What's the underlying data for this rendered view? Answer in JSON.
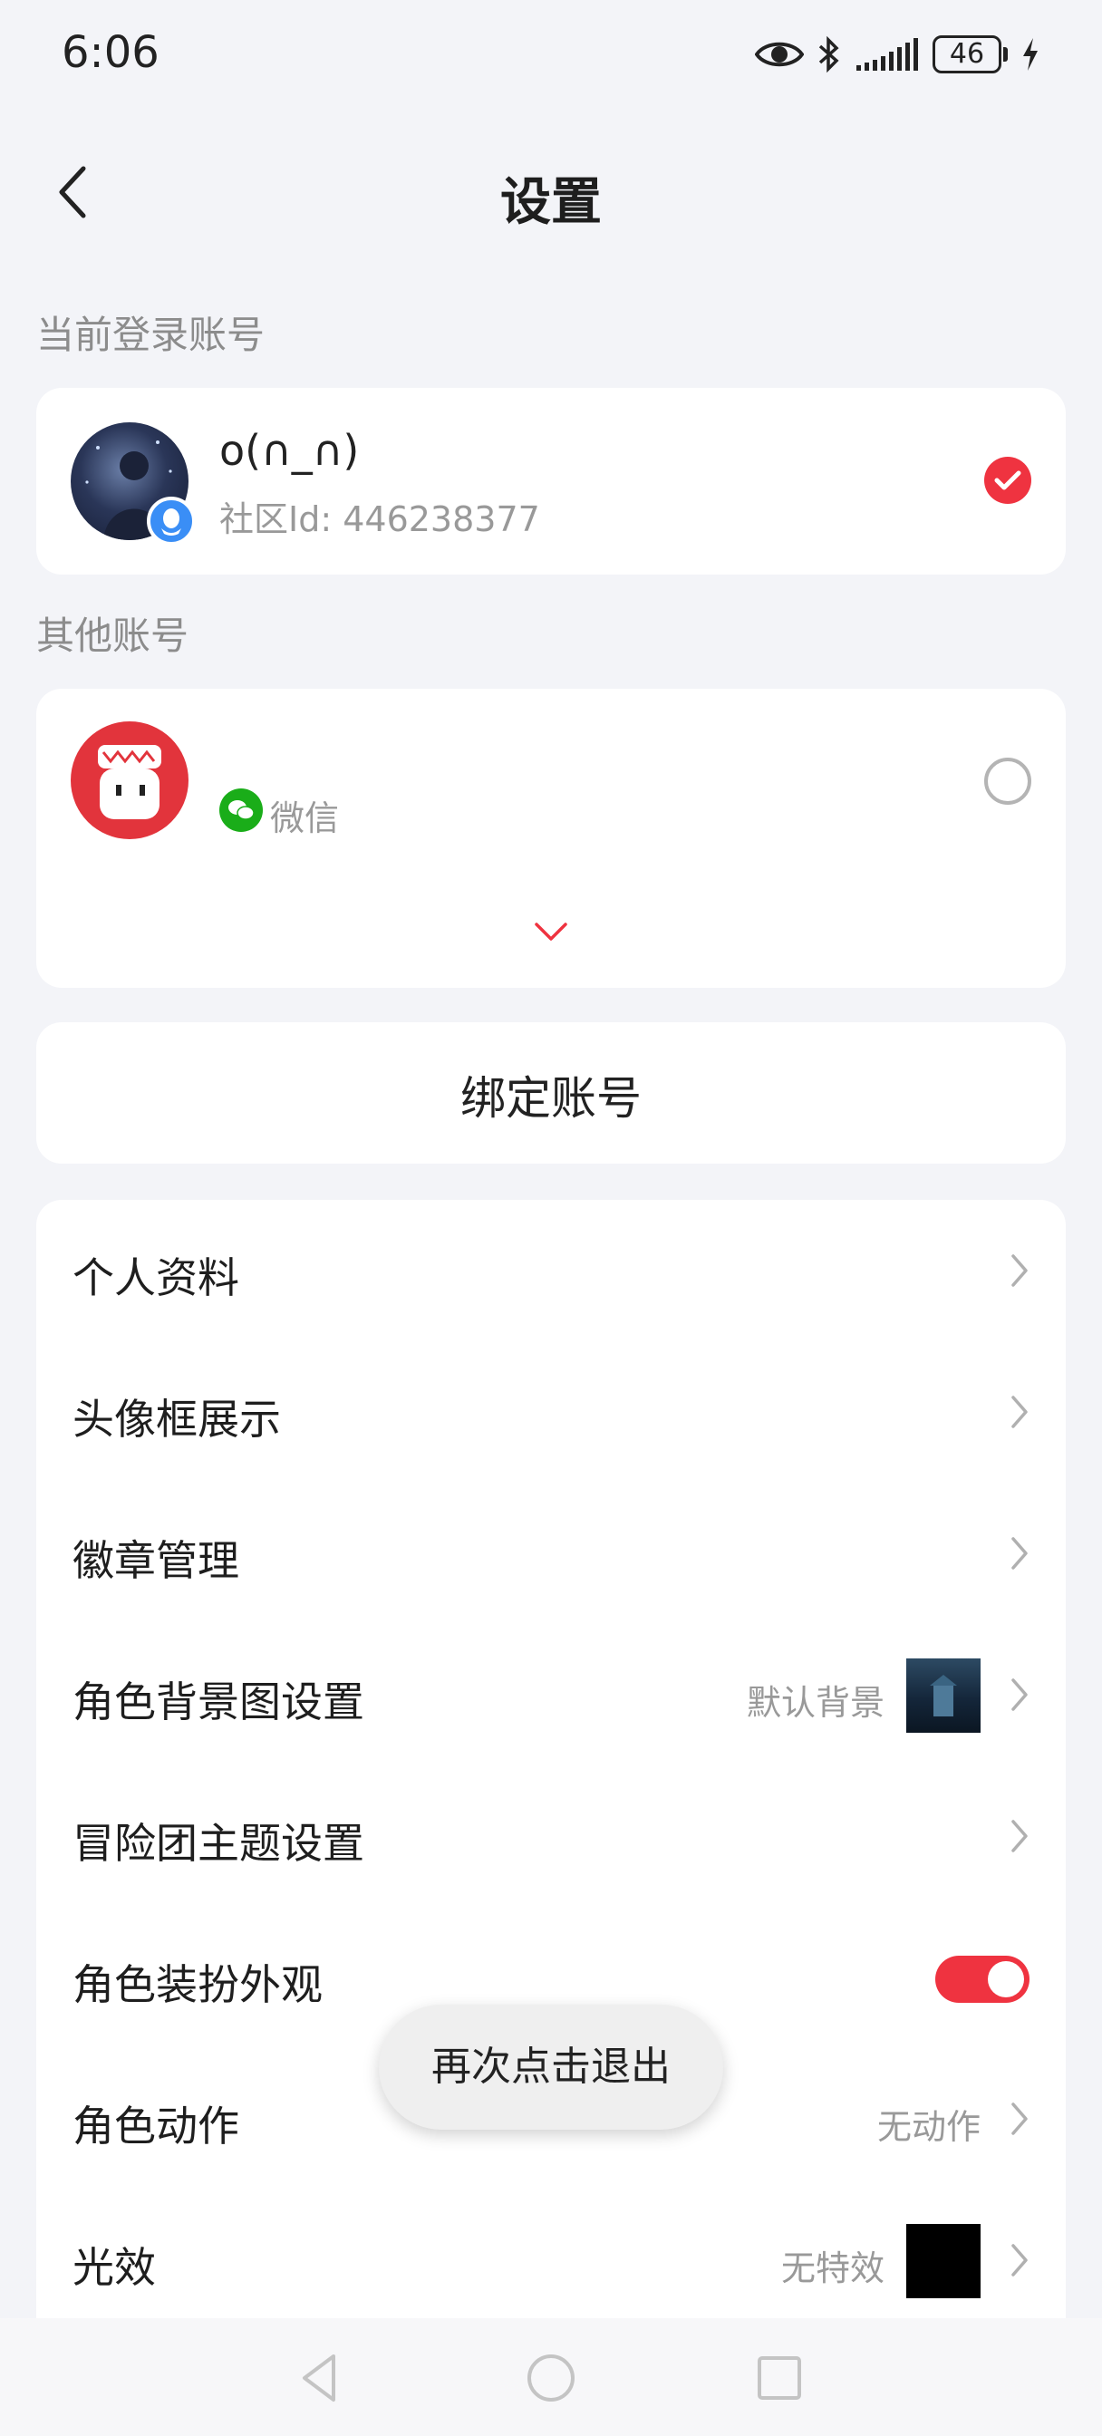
{
  "status_bar": {
    "time": "6:06",
    "battery": "46"
  },
  "header": {
    "title": "设置"
  },
  "current_account": {
    "section_label": "当前登录账号",
    "name": "o(∩_∩)",
    "community_id": "社区Id: 446238377",
    "login_type_icon": "qq-icon"
  },
  "other_accounts": {
    "section_label": "其他账号",
    "items": [
      {
        "name": "",
        "login_type": "微信",
        "login_type_icon": "wechat-icon"
      }
    ]
  },
  "bind_account": {
    "label": "绑定账号"
  },
  "menu": {
    "items": [
      {
        "label": "个人资料"
      },
      {
        "label": "头像框展示"
      },
      {
        "label": "徽章管理"
      },
      {
        "label": "角色背景图设置",
        "value": "默认背景"
      },
      {
        "label": "冒险团主题设置"
      },
      {
        "label": "角色装扮外观",
        "toggle_on": true
      },
      {
        "label": "角色动作",
        "value": "无动作"
      },
      {
        "label": "光效",
        "value": "无特效"
      }
    ]
  },
  "toast": {
    "text": "再次点击退出"
  },
  "colors": {
    "accent": "#ef3340",
    "background": "#f3f4f8",
    "card": "#ffffff",
    "wechat": "#1aad19",
    "qq": "#3a8ef6"
  }
}
